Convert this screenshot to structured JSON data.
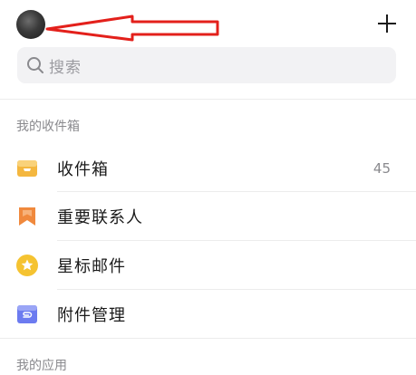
{
  "header": {
    "add_label": "+"
  },
  "search": {
    "placeholder": "搜索"
  },
  "sections": {
    "inbox_title": "我的收件箱",
    "apps_title": "我的应用"
  },
  "items": [
    {
      "label": "收件箱",
      "count": "45",
      "icon": "inbox-tray-icon",
      "color": "#f4b73f"
    },
    {
      "label": "重要联系人",
      "count": "",
      "icon": "bookmark-icon",
      "color": "#f0893d"
    },
    {
      "label": "星标邮件",
      "count": "",
      "icon": "star-icon",
      "color": "#f5c331"
    },
    {
      "label": "附件管理",
      "count": "",
      "icon": "attachment-icon",
      "color": "#6c7bf0"
    }
  ],
  "colors": {
    "annotation_red": "#e3201b",
    "search_bg": "#f2f2f4",
    "muted_text": "#8a8a8e"
  }
}
